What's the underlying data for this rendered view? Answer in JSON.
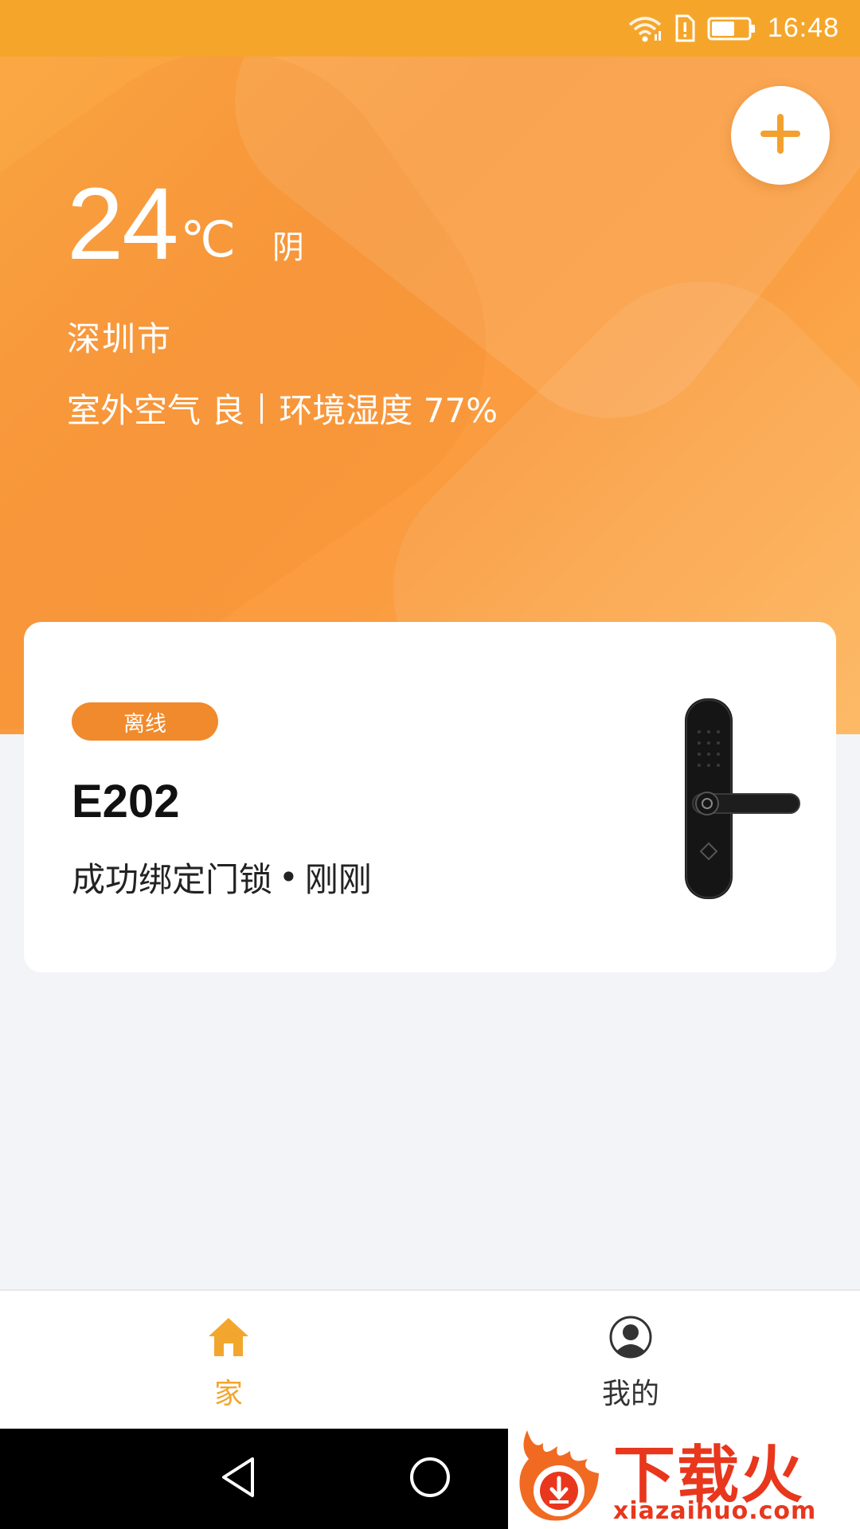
{
  "status_bar": {
    "time": "16:48",
    "icons": [
      "wifi-icon",
      "sim-alert-icon",
      "battery-icon"
    ]
  },
  "header": {
    "add_icon": "plus-icon"
  },
  "weather": {
    "temperature": "24",
    "unit": "℃",
    "condition": "阴",
    "city": "深圳市",
    "air_quality": "室外空气 良",
    "humidity": "环境湿度 77%"
  },
  "device": {
    "status": "离线",
    "name": "E202",
    "activity": "成功绑定门锁",
    "separator": "•",
    "time": "刚刚",
    "image_icon": "smart-door-lock-image"
  },
  "bottom_nav": {
    "items": [
      {
        "label": "家",
        "icon": "home-icon",
        "active": true
      },
      {
        "label": "我的",
        "icon": "profile-icon",
        "active": false
      }
    ]
  },
  "watermark": {
    "text": "下载火",
    "url": "xiazaihuo.com"
  },
  "colors": {
    "accent": "#f3a62d",
    "badge": "#f18a2c",
    "status_bar": "#f5a62a",
    "watermark": "#e8371d"
  }
}
